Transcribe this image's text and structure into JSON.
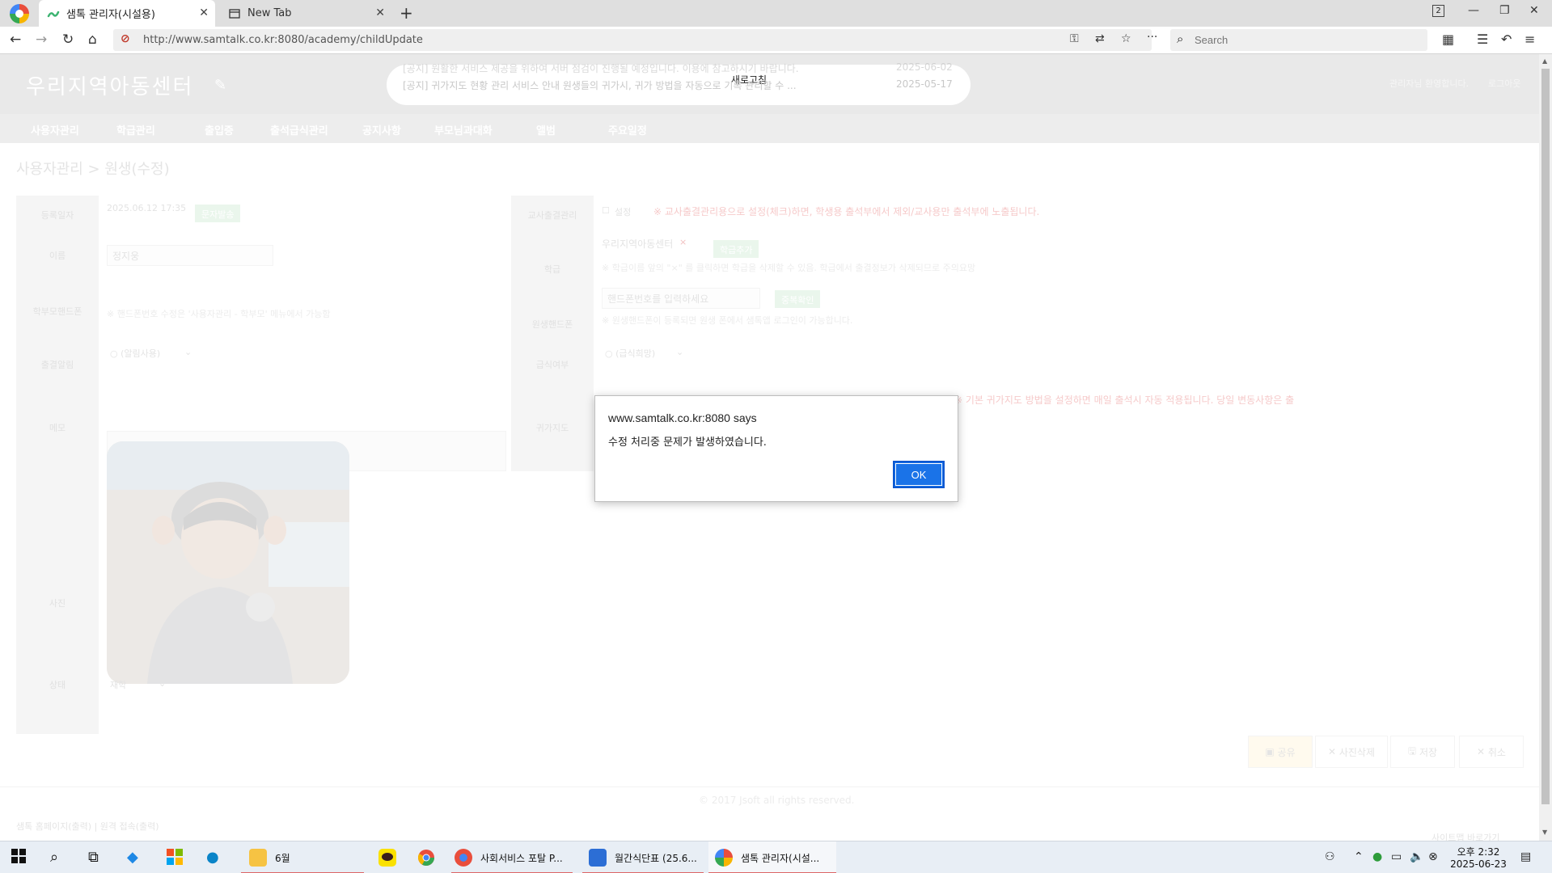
{
  "browser": {
    "tabs": [
      {
        "title": "샘톡 관리자(시설용)",
        "active": true
      },
      {
        "title": "New Tab",
        "active": false
      }
    ],
    "tab_count": "2",
    "url": "http://www.samtalk.co.kr:8080/academy/childUpdate",
    "search_placeholder": "Search"
  },
  "site": {
    "title": "우리지역아동센터",
    "notice": {
      "refresh_label": "새로고침",
      "line1": "[공지] 원활한 서비스 제공을 위하여 서버 점검이 진행될 예정입니다. 이용에 참고하시기 바랍니다.",
      "line1_date": "2025-06-02",
      "line2": "[공지] 귀가지도 현황 관리 서비스 안내 원생들의 귀가시, 귀가 방법을 자동으로 기록 관리할 수 ...",
      "line2_date": "2025-05-17"
    },
    "header_user": "관리자님 환영합니다.",
    "header_logout": "로그아웃",
    "menu": [
      "사용자관리",
      "학급관리",
      "출입증",
      "출석급식관리",
      "공지사항",
      "부모님과대화",
      "앨범",
      "주요일정"
    ],
    "breadcrumb": "사용자관리 > 원생(수정)"
  },
  "form": {
    "left": {
      "reg_date_label": "등록일자",
      "reg_date_value": "2025.06.12 17:35",
      "reg_date_badge": "문자발송",
      "name_label": "이름",
      "name_value": "정지웅",
      "parent_phone_label": "학부모핸드폰",
      "parent_phone_note": "※ 핸드폰번호 수정은 '사용자관리 - 학부모' 메뉴에서 가능함",
      "absence_label": "출결알림",
      "absence_value": "○ (알림사용)",
      "memo_label": "메모",
      "photo_label": "사진",
      "status_label": "상태",
      "status_value": "재학"
    },
    "right": {
      "teacher_label": "교사출결관리",
      "teacher_checkbox": "설정",
      "teacher_note": "※ 교사출결관리용으로 설정(체크)하면, 학생용 출석부에서 제외/교사용만 출석부에 노출됩니다.",
      "class_label": "학급",
      "class_value": "우리지역아동센터",
      "class_required": "×",
      "class_button": "학급추가",
      "class_note": "※ 학급이름 앞의 \"×\" 를 클릭하면 학급을 삭제할 수 있음. 학급에서 출결정보가 삭제되므로 주의요망",
      "child_phone_label": "원생핸드폰",
      "child_phone_placeholder": "핸드폰번호를 입력하세요",
      "child_phone_button": "중복확인",
      "child_phone_note": "※ 원생핸드폰이 등록되면 원생 폰에서 샘톡앱 로그인이 가능합니다.",
      "meal_label": "급식여부",
      "meal_value": "○ (급식희망)",
      "home_guide_label": "귀가지도",
      "home_guide_note": "※ 기본 귀가지도 방법을 설정하면 매일 출석시 자동 적용됩니다. 당일 변동사항은 출석현황에서 수정 가능합니다."
    },
    "buttons": [
      "공유",
      "사진삭제",
      "저장",
      "취소"
    ]
  },
  "footer": {
    "copyright": "© 2017 Jsoft all rights reserved.",
    "links": "샘톡 홈페이지(출력)   |   원격 접속(출력)",
    "corner": "사이트맵 바로가기"
  },
  "dialog": {
    "origin": "www.samtalk.co.kr:8080 says",
    "message": "수정 처리중 문제가 발생하였습니다.",
    "ok_label": "OK"
  },
  "taskbar": {
    "apps": [
      {
        "label": "6월",
        "icon": "folder-icon"
      },
      {
        "label": "사회서비스 포탈 P...",
        "icon": "chrome-icon"
      },
      {
        "label": "월간식단표 (25.6...",
        "icon": "hwp-icon"
      },
      {
        "label": "샘톡 관리자(시설...",
        "icon": "browser-icon"
      }
    ],
    "time": "오후 2:32",
    "date": "2025-06-23",
    "accent_color": "#e05a5a"
  }
}
